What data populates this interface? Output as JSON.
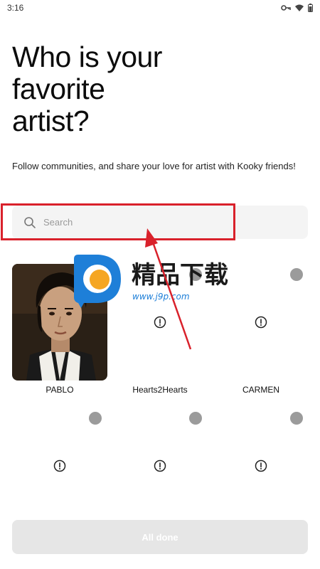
{
  "status_bar": {
    "time": "3:16"
  },
  "page": {
    "title": "Who is your\nfavorite\nartist?",
    "subtitle": "Follow communities, and share your love for artist with Kooky friends!"
  },
  "search": {
    "placeholder": "Search",
    "value": ""
  },
  "artists": [
    {
      "name": "PABLO",
      "has_photo": true
    },
    {
      "name": "Hearts2Hearts",
      "has_photo": false
    },
    {
      "name": "CARMEN",
      "has_photo": false
    },
    {
      "name": "",
      "has_photo": false
    },
    {
      "name": "",
      "has_photo": false
    },
    {
      "name": "",
      "has_photo": false
    }
  ],
  "watermark": {
    "text": "精品下载",
    "url": "www.j9p.com"
  },
  "footer": {
    "done_label": "All done"
  },
  "colors": {
    "accent_highlight": "#d9212b",
    "dot": "#9b9b9b",
    "search_bg": "#f4f4f4",
    "button_disabled": "#e6e6e6"
  }
}
